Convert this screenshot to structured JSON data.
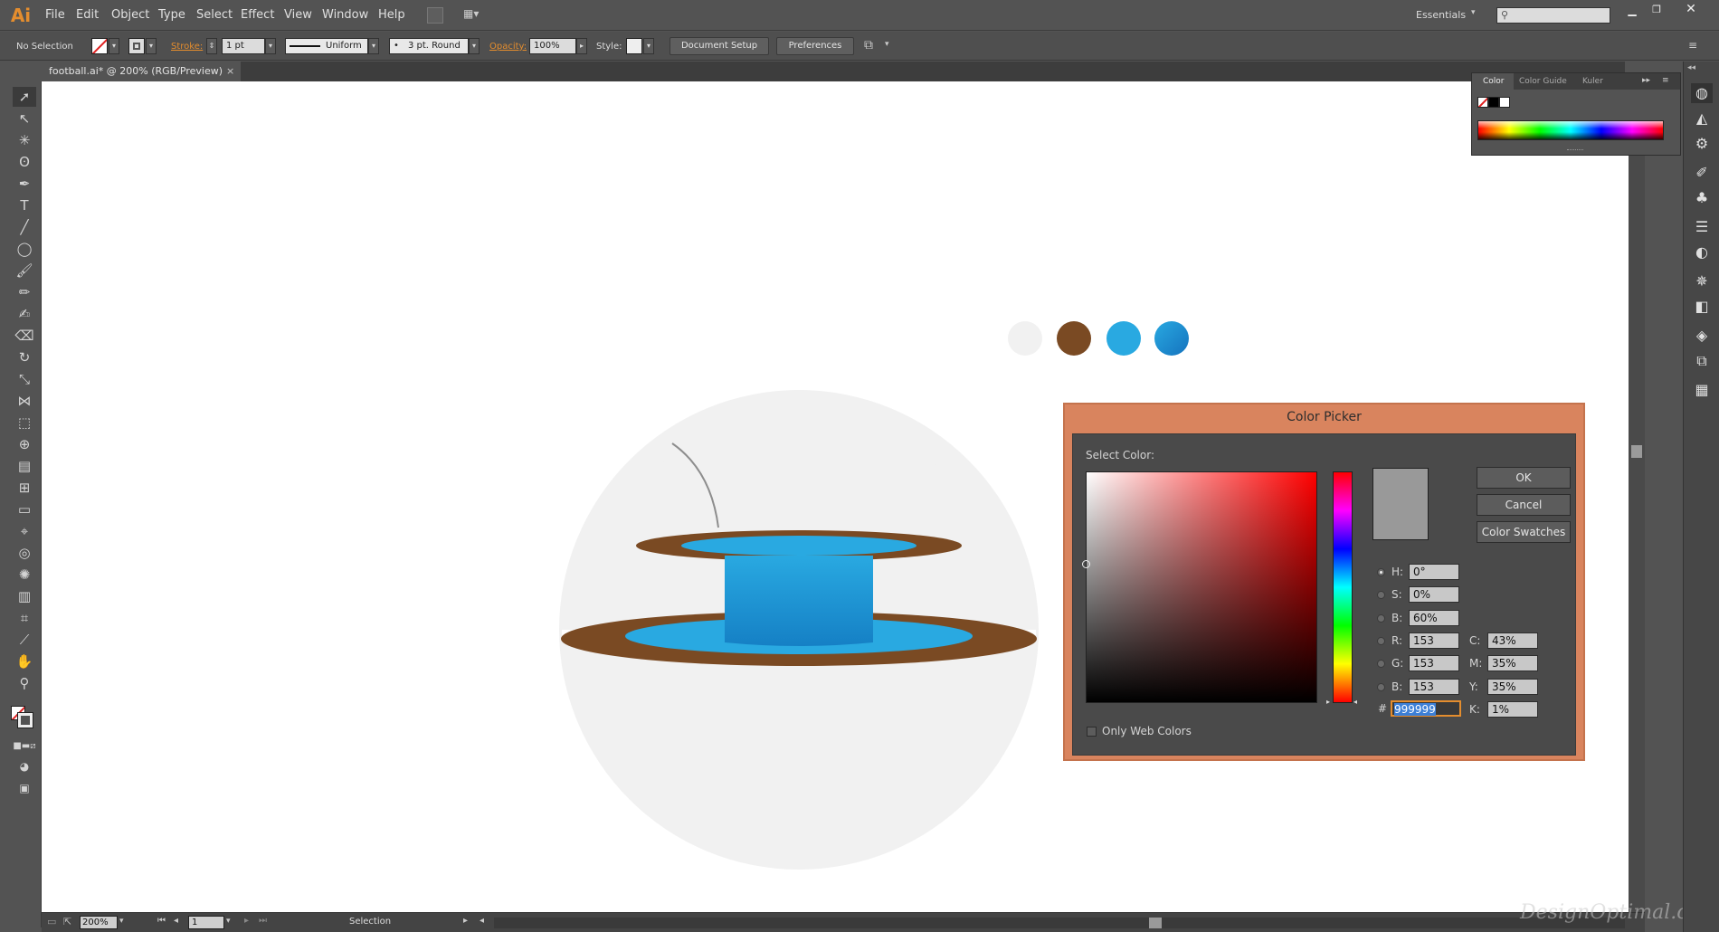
{
  "app": {
    "logo": "Ai"
  },
  "menu": [
    "File",
    "Edit",
    "Object",
    "Type",
    "Select",
    "Effect",
    "View",
    "Window",
    "Help"
  ],
  "workspace": {
    "label": "Essentials"
  },
  "control_bar": {
    "selection_status": "No Selection",
    "stroke_label": "Stroke:",
    "stroke_value": "1 pt",
    "profile_label": "Uniform",
    "brush_label": "3 pt. Round",
    "opacity_label": "Opacity:",
    "opacity_value": "100%",
    "style_label": "Style:",
    "document_setup": "Document Setup",
    "preferences": "Preferences"
  },
  "document_tab": {
    "title": "football.ai* @ 200% (RGB/Preview)",
    "close": "×"
  },
  "color_panel": {
    "tabs": [
      "Color",
      "Color Guide",
      "Kuler"
    ]
  },
  "swatches": [
    "#f1f1f1",
    "#7a4a23",
    "#29a9e1",
    "#1b85c7"
  ],
  "color_picker": {
    "title": "Color Picker",
    "select_color_label": "Select Color:",
    "ok": "OK",
    "cancel": "Cancel",
    "color_swatches": "Color Swatches",
    "only_web_colors": "Only Web Colors",
    "hsb": [
      {
        "label": "H:",
        "value": "0°"
      },
      {
        "label": "S:",
        "value": "0%"
      },
      {
        "label": "B:",
        "value": "60%"
      }
    ],
    "rgb": [
      {
        "label": "R:",
        "value": "153"
      },
      {
        "label": "G:",
        "value": "153"
      },
      {
        "label": "B:",
        "value": "153"
      }
    ],
    "cmyk": [
      {
        "label": "C:",
        "value": "43%"
      },
      {
        "label": "M:",
        "value": "35%"
      },
      {
        "label": "Y:",
        "value": "35%"
      },
      {
        "label": "K:",
        "value": "1%"
      }
    ],
    "hex_label": "#",
    "hex_value": "999999",
    "current_color": "#999999"
  },
  "status_bar": {
    "zoom": "200%",
    "artboard": "1",
    "tool": "Selection"
  },
  "watermark": "DesignOptimal.com"
}
